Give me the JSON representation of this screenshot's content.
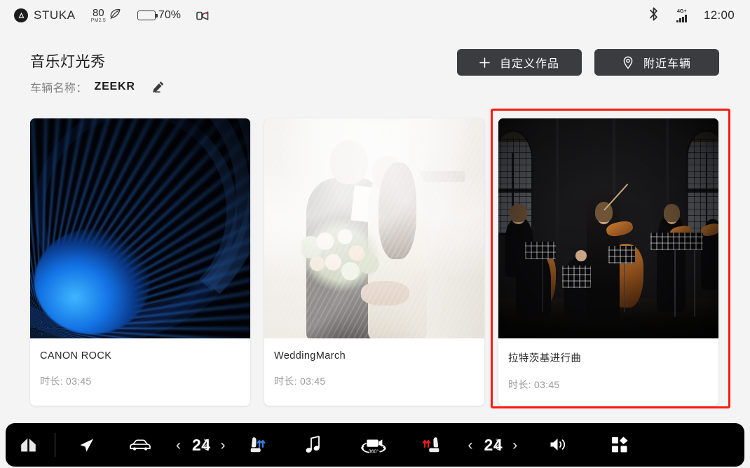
{
  "statusbar": {
    "brand": "STUKA",
    "brand_icon": "triangle-badge-icon",
    "pm25_value": "80",
    "pm25_unit": "PM2.5",
    "leaf_icon": "leaf-icon",
    "battery_percent": "70%",
    "battery_level": 70,
    "dashcam_icon": "dashcam-icon",
    "bluetooth_icon": "bluetooth-icon",
    "network_label": "4G+",
    "signal_icon": "signal-bars-icon",
    "time": "12:00"
  },
  "header": {
    "title": "音乐灯光秀",
    "vehicle_label": "车辆名称：",
    "vehicle_name": "ZEEKR",
    "edit_icon": "pencil-edit-icon",
    "actions": [
      {
        "icon": "plus-icon",
        "label": "自定义作品"
      },
      {
        "icon": "location-pin-icon",
        "label": "附近车辆"
      }
    ]
  },
  "cards": [
    {
      "title": "CANON ROCK",
      "meta": "时长: 03:45",
      "art": "blue-spiral",
      "selected": false
    },
    {
      "title": "WeddingMarch",
      "meta": "时长: 03:45",
      "art": "wedding-couple",
      "selected": false
    },
    {
      "title": "拉特茨基进行曲",
      "meta": "时长: 03:45",
      "art": "orchestra",
      "selected": true
    }
  ],
  "selection": {
    "highlight_color": "#fb1b10"
  },
  "navbar": {
    "left": [
      {
        "icon": "home-icon",
        "name": "home"
      },
      {
        "icon": "navigation-arrow-icon",
        "name": "navigation"
      },
      {
        "icon": "car-icon",
        "name": "vehicle"
      }
    ],
    "left_temp": {
      "prev": "‹",
      "value": "24",
      "degree": "°",
      "unit": "C",
      "next": "›"
    },
    "left_after": [
      {
        "icon": "seat-ventilation-icon",
        "name": "driver-seat-ventilation",
        "accent": "#2f7fe0"
      },
      {
        "icon": "music-note-icon",
        "name": "media"
      }
    ],
    "right": [
      {
        "icon": "camera-360-icon",
        "name": "surround-view",
        "label": "360°"
      },
      {
        "icon": "seat-heating-icon",
        "name": "passenger-seat-heating",
        "accent": "#e02020"
      }
    ],
    "right_temp": {
      "prev": "‹",
      "value": "24",
      "degree": "°",
      "unit": "C",
      "next": "›"
    },
    "right_after": [
      {
        "icon": "volume-icon",
        "name": "volume"
      },
      {
        "icon": "apps-grid-icon",
        "name": "apps"
      }
    ]
  }
}
